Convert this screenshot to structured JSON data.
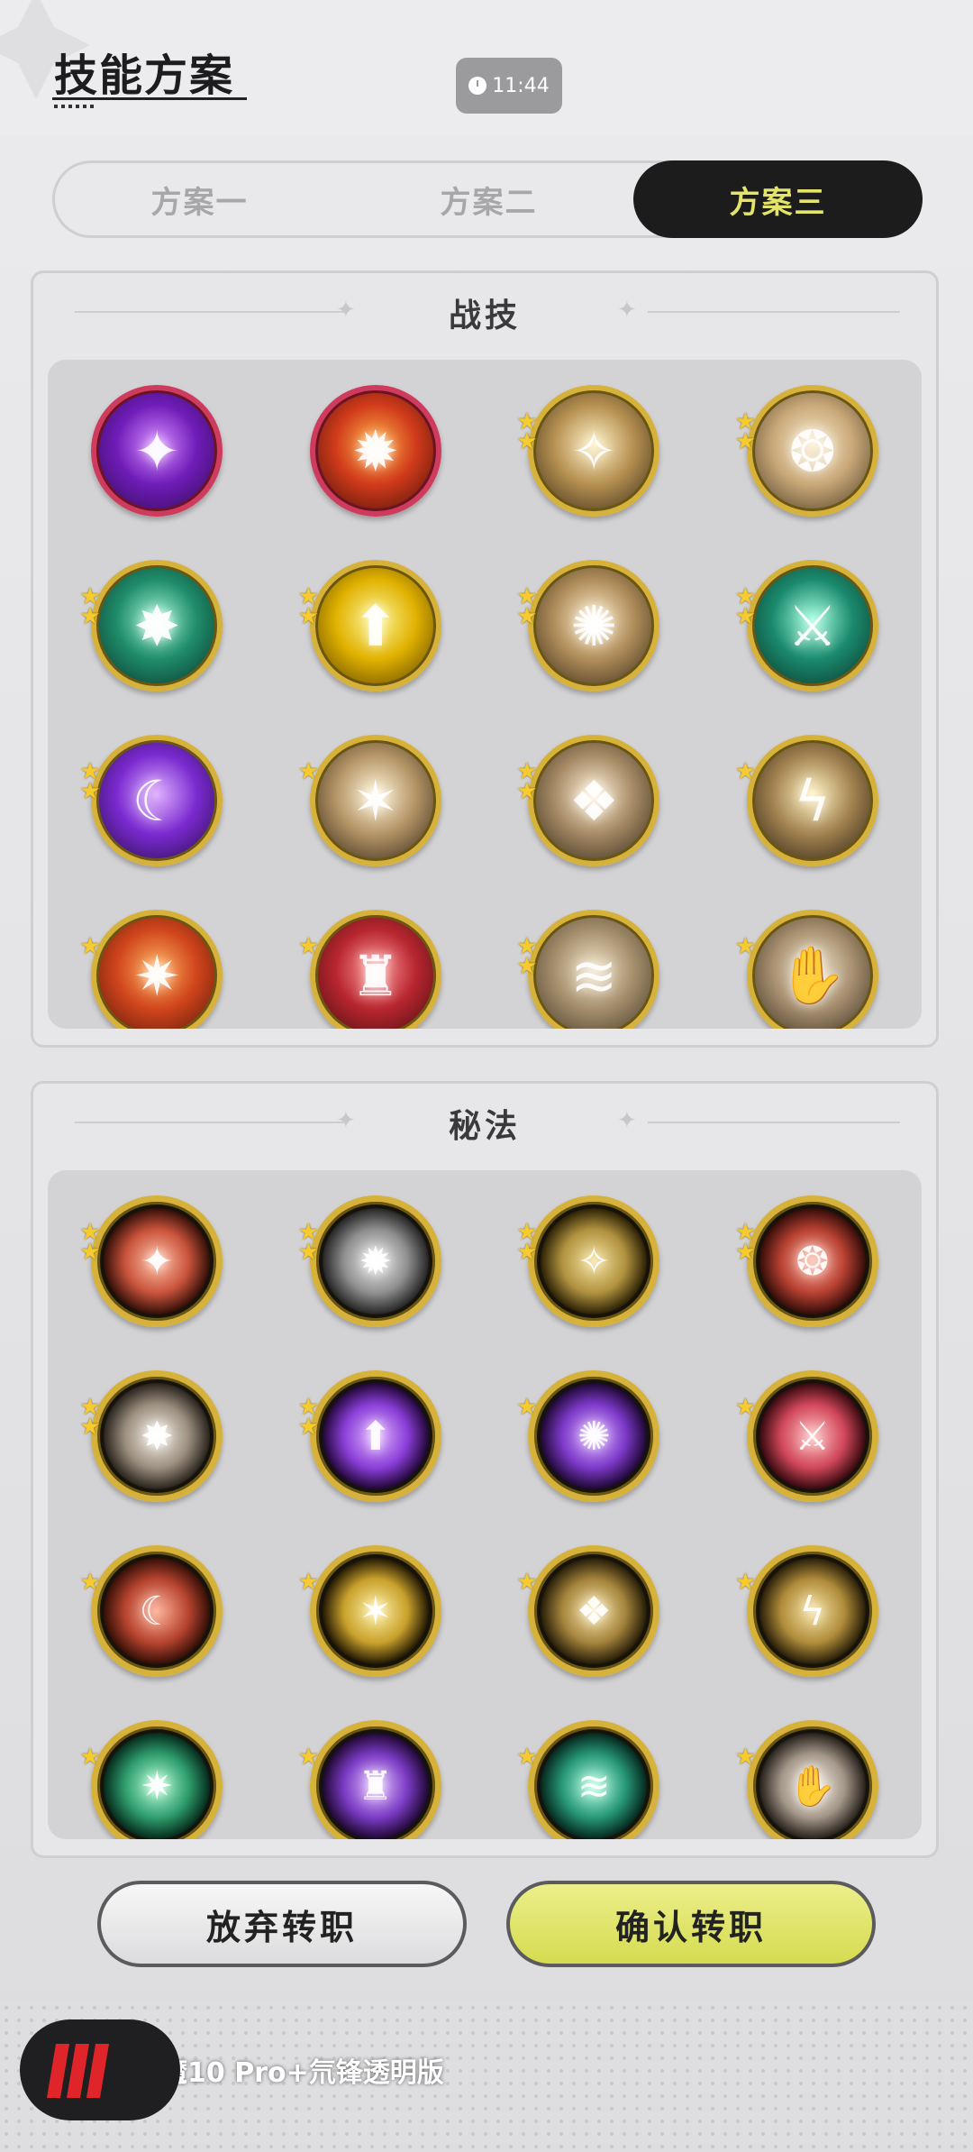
{
  "header": {
    "title": "技能方案",
    "clock": "11:44"
  },
  "tabs": [
    {
      "label": "方案一",
      "active": false
    },
    {
      "label": "方案二",
      "active": false
    },
    {
      "label": "方案三",
      "active": true
    }
  ],
  "combat_panel": {
    "title": "战技",
    "skills": [
      {
        "icon": "purple-heart-burst-icon",
        "colors": [
          "#d68cff",
          "#6f1cb8",
          "#2a0a4a"
        ],
        "rim": "red",
        "stars": 0
      },
      {
        "icon": "fire-swirl-icon",
        "colors": [
          "#ffb347",
          "#d13b1b",
          "#3a0b05"
        ],
        "rim": "red",
        "stars": 0
      },
      {
        "icon": "sword-thrust-icon",
        "colors": [
          "#fff2c8",
          "#b58f50",
          "#2e2416"
        ],
        "rim": "gold",
        "stars": 2
      },
      {
        "icon": "wind-slash-icon",
        "colors": [
          "#fbeed2",
          "#c9a878",
          "#3c2f1d"
        ],
        "rim": "gold",
        "stars": 2
      },
      {
        "icon": "green-crescent-icon",
        "colors": [
          "#9ef3d2",
          "#1f8c6a",
          "#062b23"
        ],
        "rim": "gold",
        "stars": 2
      },
      {
        "icon": "golden-shield-buff-icon",
        "colors": [
          "#fff79a",
          "#e0b100",
          "#4a3300"
        ],
        "rim": "gold",
        "stars": 2
      },
      {
        "icon": "leap-strike-icon",
        "colors": [
          "#fff0d0",
          "#b08d5a",
          "#2b2114"
        ],
        "rim": "gold",
        "stars": 2
      },
      {
        "icon": "green-sword-burst-icon",
        "colors": [
          "#a5ffe0",
          "#1b8a6c",
          "#052a22"
        ],
        "rim": "gold",
        "stars": 2
      },
      {
        "icon": "purple-spirits-icon",
        "colors": [
          "#e0b0ff",
          "#7a2ad0",
          "#1f0a3a"
        ],
        "rim": "gold",
        "stars": 2
      },
      {
        "icon": "ground-explosion-icon",
        "colors": [
          "#fff6da",
          "#b49466",
          "#231a10"
        ],
        "rim": "gold",
        "stars": 1
      },
      {
        "icon": "spike-wall-icon",
        "colors": [
          "#fff0d8",
          "#a58a64",
          "#2a2016"
        ],
        "rim": "gold",
        "stars": 2
      },
      {
        "icon": "lightning-slash-icon",
        "colors": [
          "#fff3c2",
          "#a28250",
          "#1e170d"
        ],
        "rim": "gold",
        "stars": 1
      },
      {
        "icon": "fire-sigil-icon",
        "colors": [
          "#ffb15c",
          "#d0451c",
          "#4a1206"
        ],
        "rim": "gold",
        "stars": 1
      },
      {
        "icon": "red-warrior-icon",
        "colors": [
          "#ff9a9a",
          "#b8262f",
          "#3a0a0d"
        ],
        "rim": "gold",
        "stars": 1
      },
      {
        "icon": "dash-clone-icon",
        "colors": [
          "#f2e4c8",
          "#a48e6c",
          "#3b3022"
        ],
        "rim": "gold",
        "stars": 2
      },
      {
        "icon": "grab-hand-icon",
        "colors": [
          "#f3e7cf",
          "#a89070",
          "#2a2218"
        ],
        "rim": "gold",
        "stars": 1
      }
    ]
  },
  "mystic_panel": {
    "title": "秘法",
    "skills": [
      {
        "icon": "red-fist-icon",
        "colors": [
          "#ffc2a8",
          "#c9533b",
          "#3a120a"
        ],
        "stars": 2
      },
      {
        "icon": "shield-sword-icon",
        "colors": [
          "#f0f0f0",
          "#8f8f8f",
          "#2a2a2a"
        ],
        "stars": 2
      },
      {
        "icon": "golden-golem-icon",
        "colors": [
          "#f6e2a0",
          "#b0923e",
          "#322608"
        ],
        "stars": 2
      },
      {
        "icon": "red-armor-icon",
        "colors": [
          "#ffb6a4",
          "#b84132",
          "#3a0f0a"
        ],
        "stars": 2
      },
      {
        "icon": "sword-down-icon",
        "colors": [
          "#f5efe6",
          "#9c8f80",
          "#2f2922"
        ],
        "stars": 2
      },
      {
        "icon": "purple-figure-icon",
        "colors": [
          "#e2b6ff",
          "#8a3ed8",
          "#25093d"
        ],
        "stars": 2
      },
      {
        "icon": "purple-orb-heal-icon",
        "colors": [
          "#dcb5ff",
          "#7d39c9",
          "#220a3a"
        ],
        "stars": 1
      },
      {
        "icon": "red-sword-plus-icon",
        "colors": [
          "#ffc0c0",
          "#d0475a",
          "#3d0c12"
        ],
        "stars": 1
      },
      {
        "icon": "red-ribbon-icon",
        "colors": [
          "#ffb39a",
          "#b7442f",
          "#3a1108"
        ],
        "stars": 1
      },
      {
        "icon": "golden-burst-figure-icon",
        "colors": [
          "#fff2a6",
          "#c9a12c",
          "#2a1f05"
        ],
        "stars": 1
      },
      {
        "icon": "golden-vortex-icon",
        "colors": [
          "#fbe8b0",
          "#a5843c",
          "#2b210a"
        ],
        "stars": 1
      },
      {
        "icon": "golden-armor-icon",
        "colors": [
          "#f7e3a4",
          "#b08c3a",
          "#2e230b"
        ],
        "stars": 1
      },
      {
        "icon": "green-heart-icon",
        "colors": [
          "#b8ffd8",
          "#2f9e6e",
          "#07301f"
        ],
        "stars": 1
      },
      {
        "icon": "purple-beast-icon",
        "colors": [
          "#e2c0ff",
          "#7b3bc4",
          "#220a38"
        ],
        "stars": 1
      },
      {
        "icon": "green-heal-circle-icon",
        "colors": [
          "#b4ffe4",
          "#279877",
          "#072c22"
        ],
        "stars": 1
      },
      {
        "icon": "sword-up-buff-icon",
        "colors": [
          "#f8f0e4",
          "#a4978a",
          "#2c2620"
        ],
        "stars": 1
      }
    ]
  },
  "buttons": {
    "abandon": "放弃转职",
    "confirm": "确认转职"
  },
  "watermark": {
    "text": "红魔10 Pro+氘锋透明版"
  }
}
